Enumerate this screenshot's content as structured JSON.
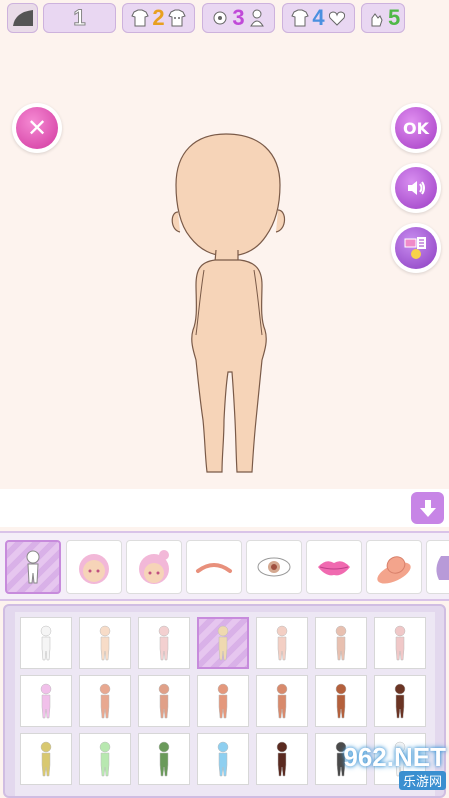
{
  "buttons": {
    "close_glyph": "✕",
    "ok_label": "OK",
    "sound_icon": "speaker-icon",
    "gallery_icon": "gallery-icon"
  },
  "categories": [
    {
      "type": "slope",
      "label": ""
    },
    {
      "type": "number",
      "label": "1"
    },
    {
      "type": "icons",
      "label": "2",
      "color": "#e8a020"
    },
    {
      "type": "icons",
      "label": "3",
      "color": "#c04ad8"
    },
    {
      "type": "icons",
      "label": "4",
      "color": "#4a90e0"
    },
    {
      "type": "icons",
      "label": "5",
      "color": "#50b848"
    }
  ],
  "parts": [
    "body",
    "hair-back",
    "hair-front",
    "eyebrows",
    "eyes",
    "mouth",
    "hat",
    "more"
  ],
  "colors": {
    "skin": "#f6d4b8",
    "accent": "#c785e6",
    "close": "#d1379f",
    "watermark": "#3a8fd0"
  },
  "swatches": [
    [
      "#f5f5f5",
      "#f7dcc8",
      "#f3d0d0",
      "#efd9b0",
      "#f3cfc4",
      "#e8c0b0",
      "#f0c8c8"
    ],
    [
      "#f1c0ea",
      "#e8a890",
      "#e0a088",
      "#e4987c",
      "#d88a6c",
      "#b4603c",
      "#6a3424"
    ],
    [
      "#d8c870",
      "#b8e8b0",
      "#6a9a5a",
      "#8ecff0",
      "#5a2a20",
      "#4a4a4a",
      "#f5f5f5"
    ]
  ],
  "watermark": {
    "main": "962.NET",
    "sub": "乐游网"
  }
}
